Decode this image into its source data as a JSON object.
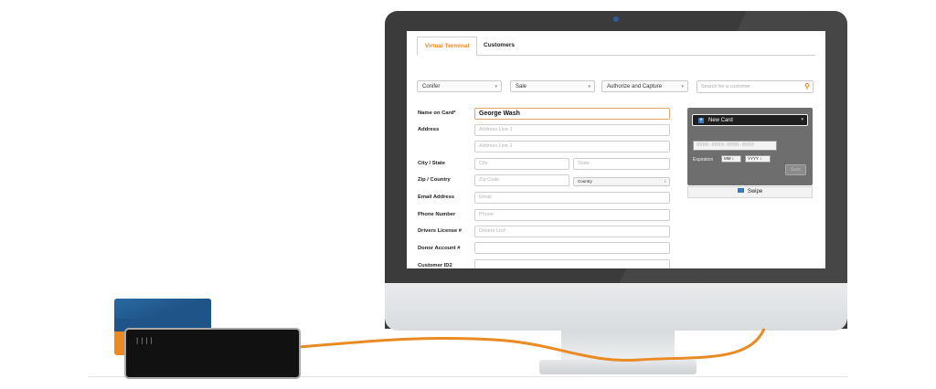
{
  "tabs": [
    {
      "label": "Virtual Terminal",
      "active": true
    },
    {
      "label": "Customers",
      "active": false
    }
  ],
  "toolbar": {
    "location_select": "Conifer",
    "type_select": "Sale",
    "mode_select": "Authorize and Capture",
    "search_placeholder": "Search for a customer"
  },
  "form": {
    "name_label": "Name on Card*",
    "name_value": "George Wash",
    "address_label": "Address",
    "address1_placeholder": "Address Line 1",
    "address2_placeholder": "Address Line 2",
    "citystate_label": "City / State",
    "city_placeholder": "City",
    "state_placeholder": "State",
    "zipcountry_label": "Zip / Country",
    "zip_placeholder": "Zip Code",
    "country_select": "Country",
    "email_label": "Email Address",
    "email_placeholder": "Email",
    "phone_label": "Phone Number",
    "phone_placeholder": "Phone",
    "license_label": "Drivers License #",
    "license_placeholder": "Drivers Lic#",
    "donor_label": "Donor Account #",
    "customerid_label": "Customer ID2"
  },
  "card_panel": {
    "new_card_label": "New Card",
    "card_number_placeholder": "0000-0000-0000-0000",
    "expiration_label": "Expiration",
    "month_select": "MM",
    "year_select": "YYYY",
    "save_label": "Save",
    "swipe_label": "Swipe"
  },
  "colors": {
    "accent": "#e58a2f",
    "link_blue": "#3977c7",
    "monitor_bezel": "#3b3b3b",
    "cable": "#e98a22"
  }
}
